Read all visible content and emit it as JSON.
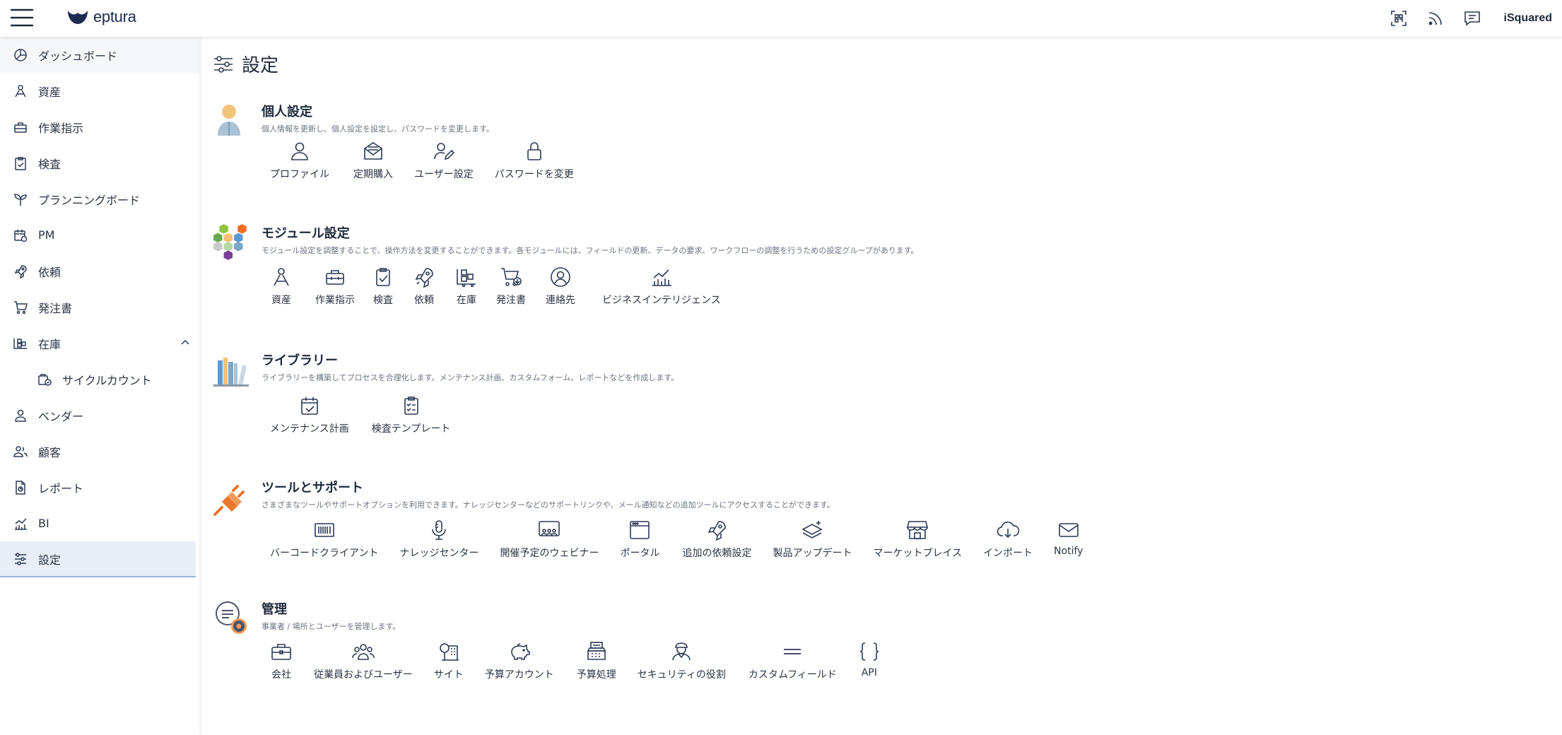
{
  "app": {
    "brand": "eptura",
    "user": "iSquared",
    "page_title": "設定"
  },
  "topbar": {
    "icons": [
      "qr-scan-icon",
      "rss-feed-icon",
      "chat-icon"
    ]
  },
  "sidebar": {
    "items": [
      {
        "label": "ダッシュボード",
        "icon": "dashboard-icon"
      },
      {
        "label": "資産",
        "icon": "asset-icon"
      },
      {
        "label": "作業指示",
        "icon": "toolbox-icon"
      },
      {
        "label": "検査",
        "icon": "clipboard-check-icon"
      },
      {
        "label": "プランニングボード",
        "icon": "sprout-icon"
      },
      {
        "label": "PM",
        "icon": "calendar-gear-icon"
      },
      {
        "label": "依頼",
        "icon": "rocket-icon"
      },
      {
        "label": "発注書",
        "icon": "cart-icon"
      },
      {
        "label": "在庫",
        "icon": "inventory-icon"
      },
      {
        "label": "サイクルカウント",
        "icon": "cycle-count-icon"
      },
      {
        "label": "ベンダー",
        "icon": "vendor-icon"
      },
      {
        "label": "顧客",
        "icon": "customers-icon"
      },
      {
        "label": "レポート",
        "icon": "report-icon"
      },
      {
        "label": "BI",
        "icon": "bi-chart-icon"
      },
      {
        "label": "設定",
        "icon": "settings-sliders-icon"
      }
    ]
  },
  "sections": {
    "personal": {
      "title": "個人設定",
      "desc": "個人情報を更新し、個人設定を設定し、パスワードを変更します。",
      "items": [
        {
          "label": "プロファイル",
          "icon": "profile-icon"
        },
        {
          "label": "定期購入",
          "icon": "subscription-icon"
        },
        {
          "label": "ユーザー設定",
          "icon": "user-edit-icon"
        },
        {
          "label": "パスワードを変更",
          "icon": "lock-icon"
        }
      ]
    },
    "module": {
      "title": "モジュール設定",
      "desc": "モジュール設定を調整することで、操作方法を変更することができます。各モジュールには、フィールドの更新、データの要求、ワークフローの調整を行うための設定グループがあります。",
      "items": [
        {
          "label": "資産",
          "icon": "asset-icon"
        },
        {
          "label": "作業指示",
          "icon": "toolbox-icon"
        },
        {
          "label": "検査",
          "icon": "clipboard-check-icon"
        },
        {
          "label": "依頼",
          "icon": "rocket-icon"
        },
        {
          "label": "在庫",
          "icon": "inventory-icon"
        },
        {
          "label": "発注書",
          "icon": "cart-icon"
        },
        {
          "label": "連絡先",
          "icon": "contact-icon"
        },
        {
          "label": "ビジネスインテリジェンス",
          "icon": "bi-chart-icon"
        }
      ]
    },
    "library": {
      "title": "ライブラリー",
      "desc": "ライブラリーを構築してプロセスを合理化します。メンテナンス計画、カスタムフォーム、レポートなどを作成します。",
      "items": [
        {
          "label": "メンテナンス計画",
          "icon": "calendar-check-icon"
        },
        {
          "label": "検査テンプレート",
          "icon": "checklist-icon"
        }
      ]
    },
    "tools": {
      "title": "ツールとサポート",
      "desc": "さまざまなツールやサポートオプションを利用できます。ナレッジセンターなどのサポートリンクや、メール通知などの追加ツールにアクセスすることができます。",
      "items": [
        {
          "label": "バーコードクライアント",
          "icon": "barcode-icon"
        },
        {
          "label": "ナレッジセンター",
          "icon": "microphone-icon"
        },
        {
          "label": "開催予定のウェビナー",
          "icon": "webinar-icon"
        },
        {
          "label": "ポータル",
          "icon": "portal-icon"
        },
        {
          "label": "追加の依頼設定",
          "icon": "rocket-icon"
        },
        {
          "label": "製品アップデート",
          "icon": "layers-icon"
        },
        {
          "label": "マーケットプレイス",
          "icon": "store-icon"
        },
        {
          "label": "インポート",
          "icon": "cloud-download-icon"
        },
        {
          "label": "Notify",
          "icon": "mail-icon"
        }
      ]
    },
    "admin": {
      "title": "管理",
      "desc": "事業者 / 場所とユーザーを管理します。",
      "items": [
        {
          "label": "会社",
          "icon": "briefcase-icon"
        },
        {
          "label": "従業員およびユーザー",
          "icon": "users-icon"
        },
        {
          "label": "サイト",
          "icon": "site-icon"
        },
        {
          "label": "予算アカウント",
          "icon": "piggy-bank-icon"
        },
        {
          "label": "予算処理",
          "icon": "cash-register-icon"
        },
        {
          "label": "セキュリティの役割",
          "icon": "security-role-icon"
        },
        {
          "label": "カスタムフィールド",
          "icon": "equals-icon"
        },
        {
          "label": "API",
          "icon": "braces-icon"
        }
      ]
    }
  },
  "colors": {
    "text": "#1e2a3a",
    "icon": "#2b3a55",
    "active_bg": "#e9eef6",
    "accent_orange": "#e8762b"
  }
}
